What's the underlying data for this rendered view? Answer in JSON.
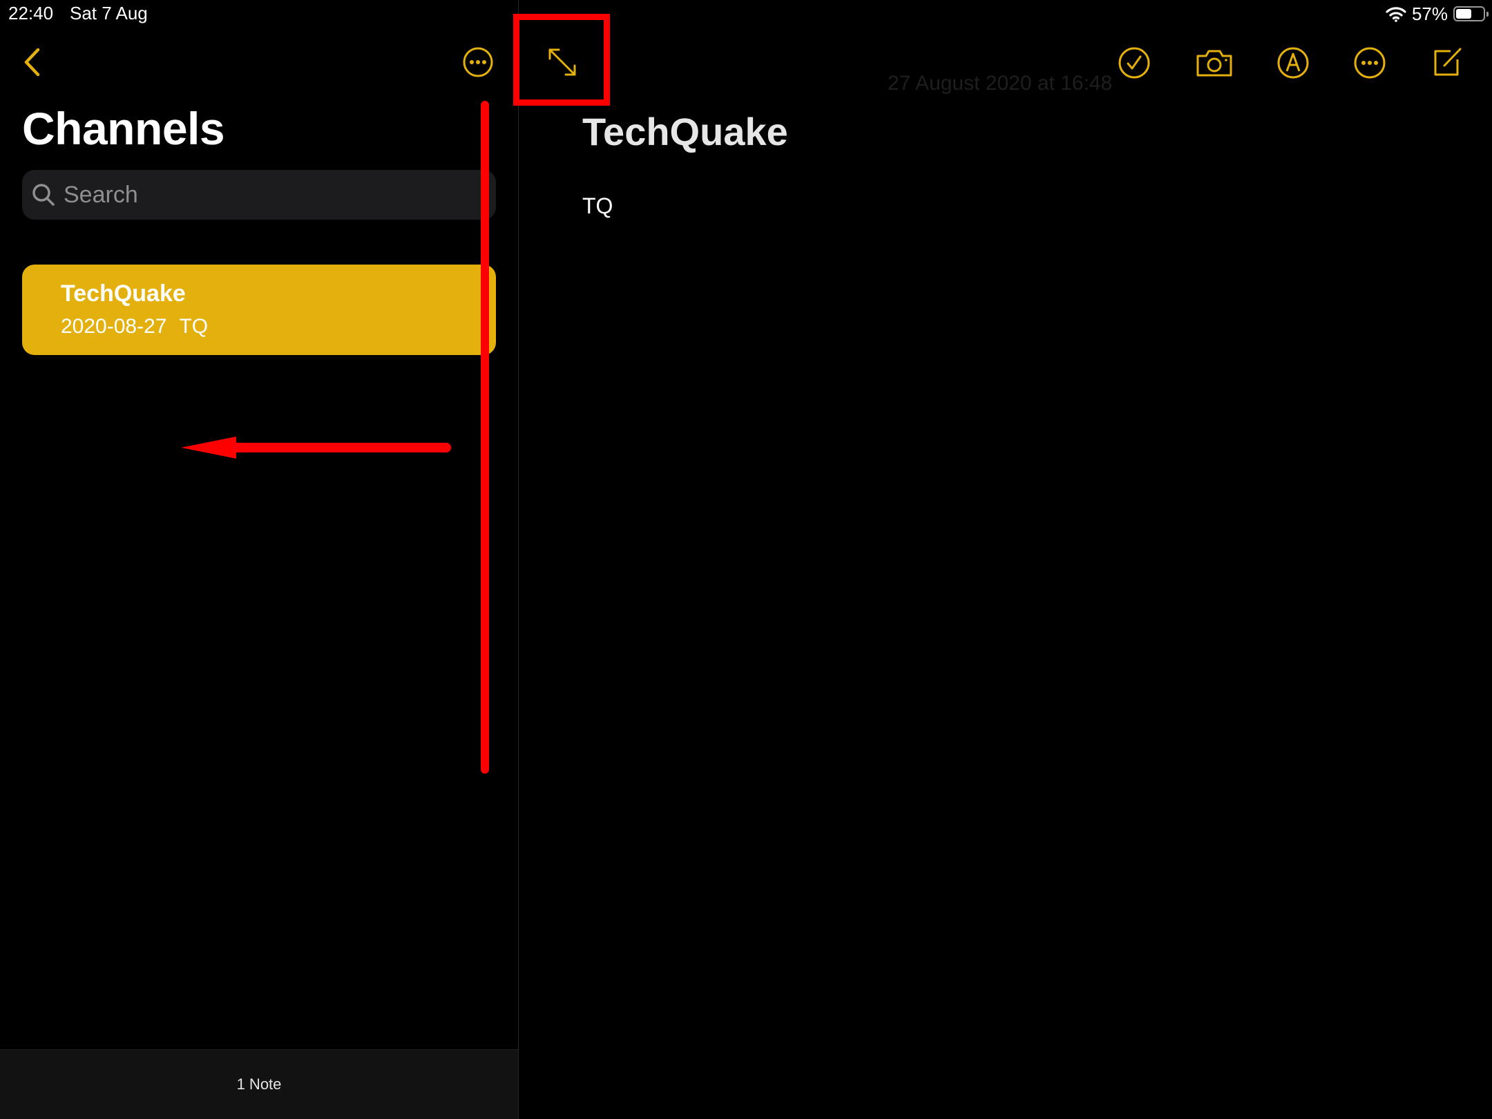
{
  "status_bar": {
    "time": "22:40",
    "date": "Sat 7 Aug",
    "battery_percent_label": "57%",
    "battery_level": 0.57
  },
  "sidebar": {
    "title": "Channels",
    "search": {
      "placeholder": "Search",
      "value": ""
    },
    "notes": [
      {
        "title": "TechQuake",
        "date": "2020-08-27",
        "preview": "TQ",
        "selected": true
      }
    ],
    "footer_count": "1 Note"
  },
  "note": {
    "timestamp": "27 August 2020 at 16:48",
    "title": "TechQuake",
    "body": "TQ"
  },
  "icons": {
    "back": "chevron-left-icon",
    "sidebar_more": "ellipsis-circle-icon",
    "expand": "expand-arrows-icon",
    "checklist": "checkmark-circle-icon",
    "camera": "camera-icon",
    "markup": "pen-tip-circle-icon",
    "more": "ellipsis-circle-icon",
    "compose": "compose-icon",
    "search": "magnifying-glass-icon",
    "wifi": "wifi-icon",
    "battery": "battery-icon"
  },
  "colors": {
    "accent": "#e3b00d",
    "background": "#000000",
    "annotation": "#ff0000",
    "search_field": "#1c1c1e"
  }
}
